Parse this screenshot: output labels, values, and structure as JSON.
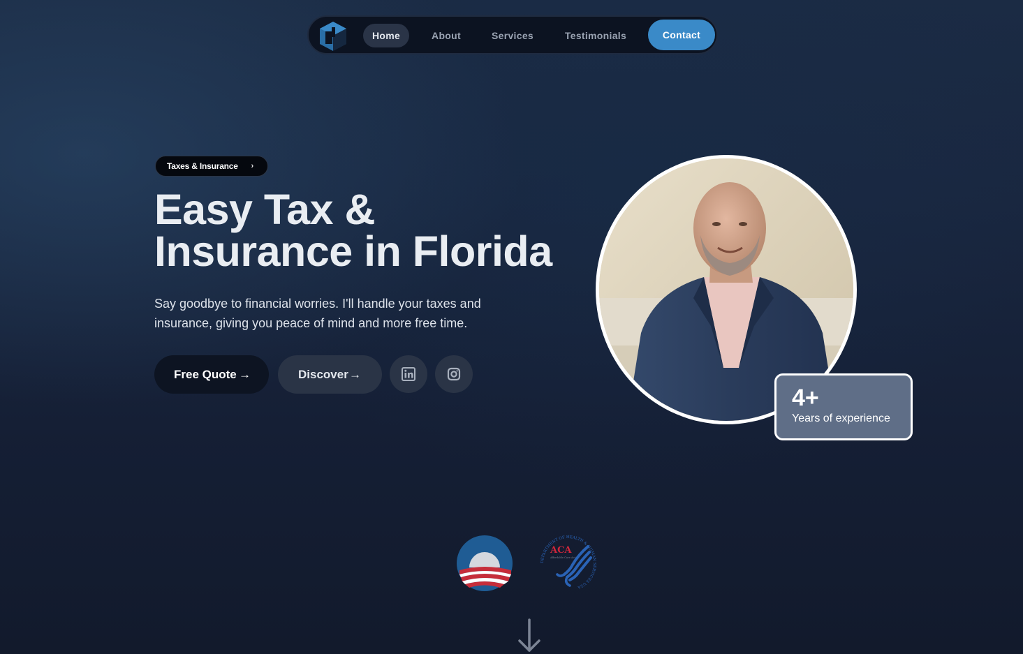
{
  "nav": {
    "items": [
      {
        "label": "Home",
        "active": true
      },
      {
        "label": "About"
      },
      {
        "label": "Services"
      },
      {
        "label": "Testimonials"
      }
    ],
    "contact_label": "Contact",
    "logo_icon": "brand-logo-icon"
  },
  "hero": {
    "badge": "Taxes & Insurance",
    "badge_chevron": "›",
    "title_line1": "Easy Tax &",
    "title_line2": "Insurance in Florida",
    "subtitle": "Say goodbye to financial worries. I'll handle your taxes and insurance, giving you peace of mind and more free time.",
    "buttons": {
      "quote_label": "Free Quote",
      "discover_label": "Discover",
      "arrow": "→"
    },
    "social": [
      "linkedin-icon",
      "instagram-icon"
    ]
  },
  "experience": {
    "value": "4+",
    "label": "Years of experience"
  },
  "partner_logos": {
    "aca_text": "ACA",
    "aca_subtext": "Affordable Care Act",
    "aca_ring_text": "DEPARTMENT OF HEALTH & HUMAN SERVICES USA"
  },
  "colors": {
    "accent": "#3a8ac8",
    "nav_bg": "#0c1321",
    "card_bg": "#5f6e87"
  }
}
